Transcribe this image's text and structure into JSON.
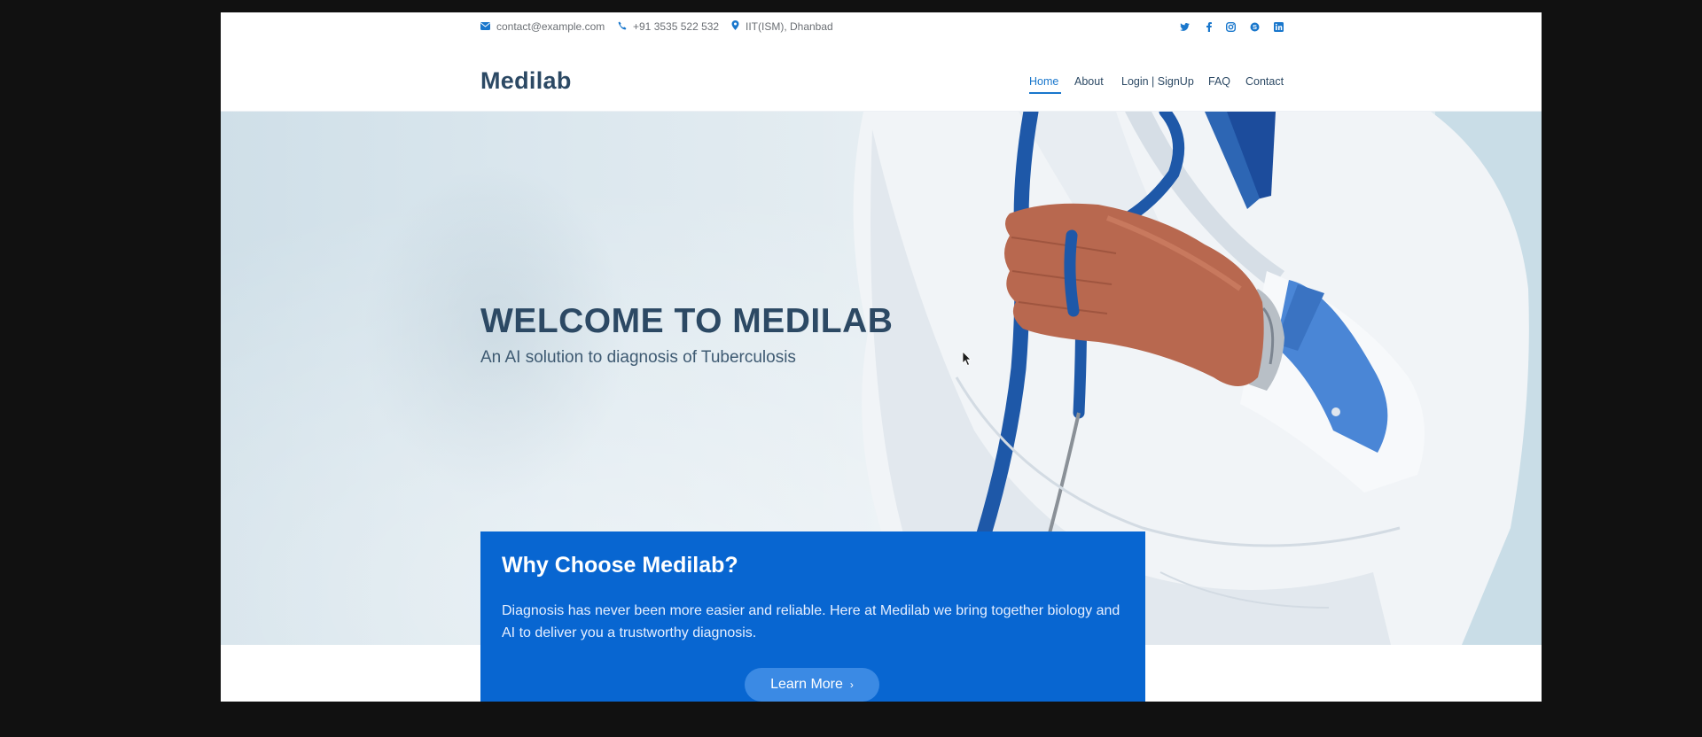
{
  "topbar": {
    "email": "contact@example.com",
    "phone": "+91 3535 522 532",
    "location": "IIT(ISM), Dhanbad",
    "icons": [
      "envelope-icon",
      "phone-icon",
      "map-pin-icon"
    ],
    "social": [
      "twitter-icon",
      "facebook-icon",
      "instagram-icon",
      "skype-icon",
      "linkedin-icon"
    ]
  },
  "header": {
    "logo": "Medilab",
    "nav": [
      "Home",
      "About",
      "Login | SignUp",
      "FAQ",
      "Contact"
    ],
    "active_nav": "Home"
  },
  "hero": {
    "title": "WELCOME TO MEDILAB",
    "subtitle": "An AI solution to diagnosis of Tuberculosis"
  },
  "why": {
    "title": "Why Choose Medilab?",
    "text": "Diagnosis has never been more easier and reliable. Here at Medilab we bring together biology and AI to deliver you a trustworthy diagnosis.",
    "button": "Learn More"
  },
  "colors": {
    "primary": "#1977cc",
    "box": "#0866d1",
    "heading": "#2c4964",
    "frame_bg": "#111111"
  }
}
